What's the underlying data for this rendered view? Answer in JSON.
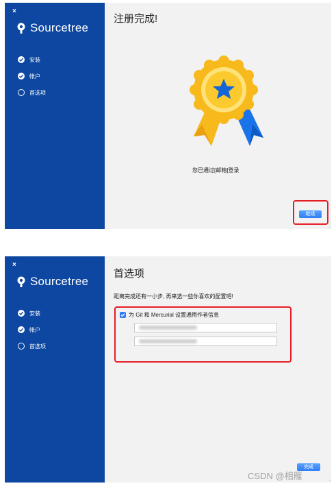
{
  "app": {
    "close_glyph": "×",
    "brand_name": "Sourcetree",
    "logo_icon": "sourcetree-logo-icon"
  },
  "steps": [
    {
      "label": "安装",
      "state": "done"
    },
    {
      "label": "帐户",
      "state": "done"
    },
    {
      "label": "首选项",
      "state": "pending"
    }
  ],
  "screen1": {
    "title": "注册完成!",
    "medal_icon": "award-ribbon-icon",
    "login_text": "您已通过[邮箱]登录",
    "continue_label": "继续"
  },
  "screen2": {
    "title": "首选项",
    "subtitle": "距离完成还有一小步, 再来选一些你喜欢的配置吧!",
    "git_checkbox_label": "为 Git 和 Mercurial 设置通用作者信息",
    "git_checked": true,
    "finish_label": "完成"
  },
  "watermark": "CSDN @相雁",
  "colors": {
    "sidebar": "#0d47a1",
    "highlight": "#e51c23",
    "button": "#2f7ef5",
    "window_bg": "#f2f2f2"
  }
}
